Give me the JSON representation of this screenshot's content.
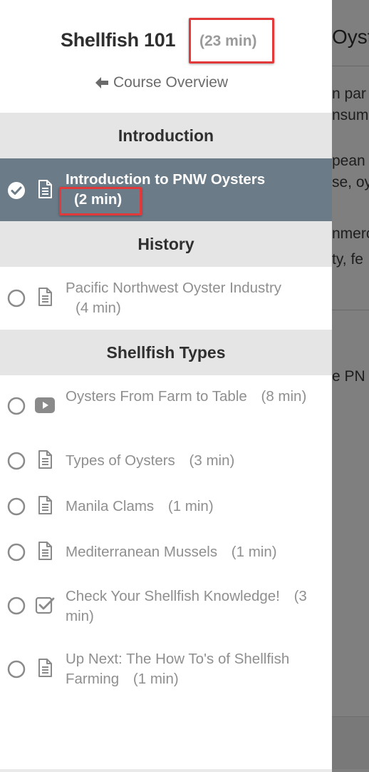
{
  "background_page": {
    "title_fragment": "Oyste",
    "text_lines": [
      "n par",
      "nsum",
      "pean",
      "se, oy",
      "nmerc",
      "ty, fe",
      "e PN"
    ]
  },
  "course": {
    "title": "Shellfish 101",
    "duration": "(23 min)",
    "overview_label": "Course Overview"
  },
  "sections": [
    {
      "title": "Introduction",
      "lessons": [
        {
          "title": "Introduction to PNW Oysters",
          "duration": "(2 min)",
          "type": "document-icon",
          "completed": true,
          "active": true
        }
      ]
    },
    {
      "title": "History",
      "lessons": [
        {
          "title": "Pacific Northwest Oyster Industry",
          "duration": "(4 min)",
          "type": "document-icon",
          "completed": false,
          "active": false
        }
      ]
    },
    {
      "title": "Shellfish Types",
      "lessons": [
        {
          "title": "Oysters From Farm to Table",
          "duration": "(8 min)",
          "type": "video-icon",
          "completed": false,
          "active": false
        },
        {
          "title": "Types of Oysters",
          "duration": "(3 min)",
          "type": "document-icon",
          "completed": false,
          "active": false
        },
        {
          "title": "Manila Clams",
          "duration": "(1 min)",
          "type": "document-icon",
          "completed": false,
          "active": false
        },
        {
          "title": "Mediterranean Mussels",
          "duration": "(1 min)",
          "type": "document-icon",
          "completed": false,
          "active": false
        },
        {
          "title": "Check Your Shellfish Knowledge!",
          "duration": "(3 min)",
          "type": "quiz-icon",
          "completed": false,
          "active": false
        },
        {
          "title": "Up Next: The How To's of Shellfish Farming",
          "duration": "(1 min)",
          "type": "document-icon",
          "completed": false,
          "active": false
        }
      ]
    }
  ],
  "colors": {
    "active_row": "#6b7b88",
    "section_header": "#e5e5e5",
    "highlight_box": "#e23a3a",
    "muted_text": "#8f8f8f"
  }
}
